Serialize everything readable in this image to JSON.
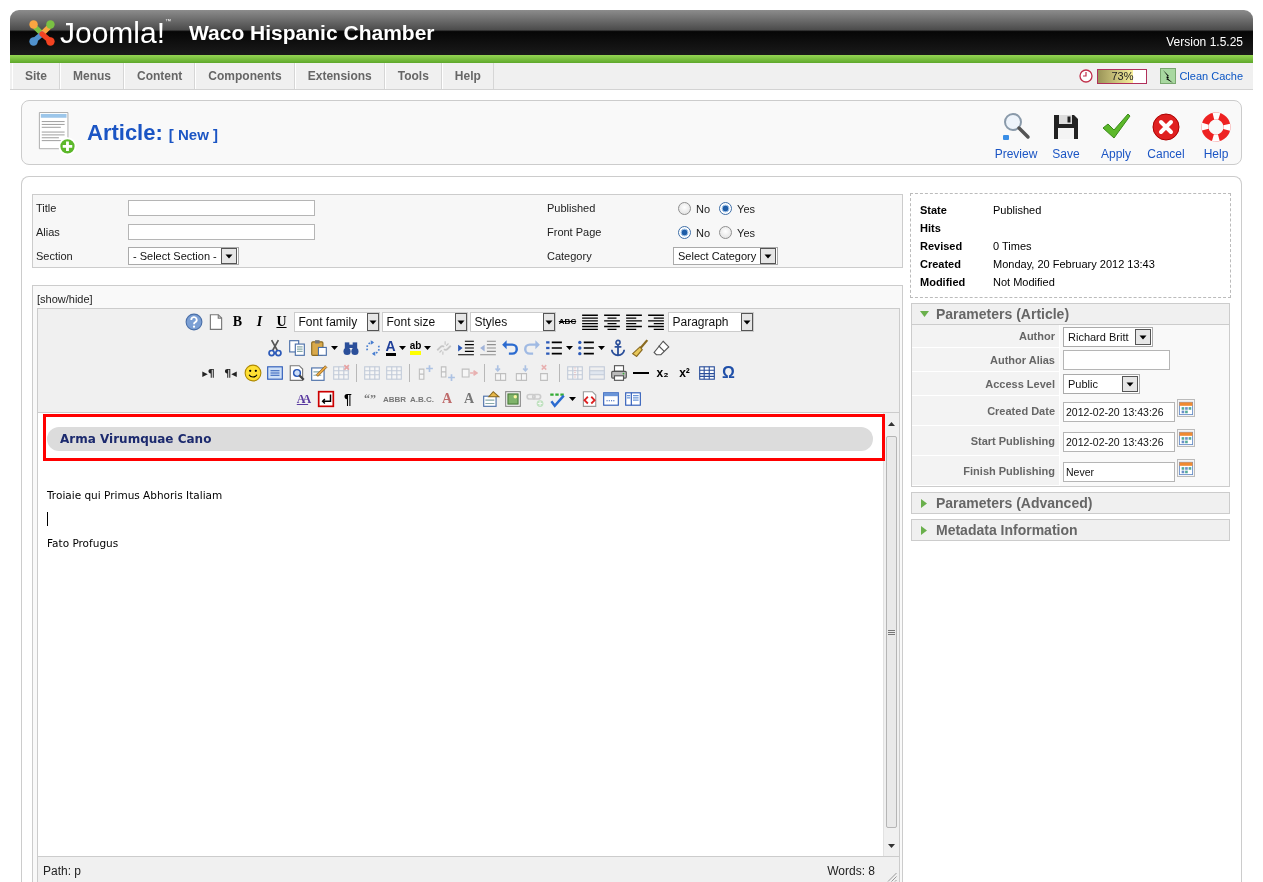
{
  "header": {
    "logo_text": "Joomla!$^{™}$",
    "site_name": "Waco Hispanic Chamber",
    "version": "Version 1.5.25"
  },
  "menu": {
    "items": [
      "Site",
      "Menus",
      "Content",
      "Components",
      "Extensions",
      "Tools",
      "Help"
    ],
    "session": {
      "level": 0.73,
      "reading": "73%"
    },
    "clean_cache": "Clean Cache"
  },
  "page_toolbar": {
    "title": "Article:",
    "subtitle": "[ New ]",
    "buttons": [
      "Preview",
      "Save",
      "Apply",
      "Cancel",
      "Help"
    ]
  },
  "form": {
    "rows": [
      [
        {
          "label": "Title",
          "kind": "text"
        },
        {
          "label": "Published",
          "kind": "radio",
          "options": [
            {
              "label": "No",
              "selected": false
            },
            {
              "label": "Yes",
              "selected": true
            }
          ]
        }
      ],
      [
        {
          "label": "Alias",
          "kind": "text"
        },
        {
          "label": "Front Page",
          "kind": "radio",
          "options": [
            {
              "label": "No",
              "selected": true
            },
            {
              "label": "Yes",
              "selected": false
            }
          ]
        }
      ],
      [
        {
          "label": "Section",
          "kind": "select",
          "value": "- Select Section -"
        },
        {
          "label": "Category",
          "kind": "select",
          "value": "Select Category"
        }
      ]
    ]
  },
  "editor": {
    "toggle": "[show/hide]",
    "toolbar": {
      "rows": [
        {
          "groups": [
            [
              {
                "kind": "icon",
                "disabled": false
              },
              {
                "kind": "icon",
                "disabled": false
              },
              {
                "kind": "glyph",
                "label": "B",
                "disabled": false
              },
              {
                "kind": "glyph",
                "label": "I",
                "disabled": false
              },
              {
                "kind": "glyph",
                "label": "U",
                "disabled": false
              },
              {
                "kind": "select",
                "label": "Font family",
                "disabled": false
              },
              {
                "kind": "select",
                "label": "Font size",
                "disabled": false
              },
              {
                "kind": "select",
                "label": "Styles",
                "disabled": false
              },
              {
                "kind": "glyph",
                "label": "ABC",
                "disabled": false
              },
              {
                "kind": "icon",
                "disabled": false
              },
              {
                "kind": "icon",
                "disabled": false
              },
              {
                "kind": "icon",
                "disabled": false
              },
              {
                "kind": "icon",
                "disabled": false
              },
              {
                "kind": "select",
                "label": "Paragraph",
                "disabled": false
              }
            ]
          ]
        },
        {
          "groups": [
            [
              {
                "kind": "icon",
                "disabled": false
              },
              {
                "kind": "icon",
                "disabled": false
              },
              {
                "kind": "icon",
                "disabled": false
              },
              {
                "kind": "icon",
                "disabled": false
              },
              {
                "kind": "icon",
                "disabled": false
              },
              {
                "kind": "glyph",
                "label": "A",
                "disabled": false
              },
              {
                "kind": "glyph",
                "label": "ab",
                "disabled": false
              },
              {
                "kind": "icon",
                "disabled": true
              },
              {
                "kind": "icon",
                "disabled": false
              },
              {
                "kind": "icon",
                "disabled": true
              },
              {
                "kind": "icon",
                "disabled": false
              },
              {
                "kind": "icon",
                "disabled": true
              },
              {
                "kind": "icon",
                "disabled": false
              },
              {
                "kind": "icon",
                "disabled": false
              },
              {
                "kind": "icon",
                "disabled": false
              },
              {
                "kind": "icon",
                "disabled": false
              },
              {
                "kind": "icon",
                "disabled": false
              }
            ]
          ]
        },
        {
          "groups": [
            [
              {
                "kind": "glyph",
                "label": "▸¶",
                "disabled": false
              },
              {
                "kind": "glyph",
                "label": "¶◂",
                "disabled": false
              },
              {
                "kind": "icon",
                "disabled": false
              },
              {
                "kind": "icon",
                "disabled": false
              },
              {
                "kind": "icon",
                "disabled": false
              },
              {
                "kind": "icon",
                "disabled": false
              },
              {
                "kind": "icon",
                "disabled": true
              }
            ],
            [
              {
                "kind": "icon",
                "disabled": true
              },
              {
                "kind": "icon",
                "disabled": true
              }
            ],
            [
              {
                "kind": "icon",
                "disabled": true
              },
              {
                "kind": "icon",
                "disabled": true
              },
              {
                "kind": "icon",
                "disabled": true
              }
            ],
            [
              {
                "kind": "icon",
                "disabled": true
              },
              {
                "kind": "icon",
                "disabled": true
              },
              {
                "kind": "icon",
                "disabled": true
              }
            ],
            [
              {
                "kind": "icon",
                "disabled": true
              },
              {
                "kind": "icon",
                "disabled": true
              },
              {
                "kind": "icon",
                "disabled": false
              },
              {
                "kind": "icon",
                "disabled": false
              },
              {
                "kind": "glyph",
                "label": "x₂",
                "disabled": false
              },
              {
                "kind": "glyph",
                "label": "x²",
                "disabled": false
              },
              {
                "kind": "icon",
                "disabled": false
              },
              {
                "kind": "glyph",
                "label": "Ω",
                "disabled": false
              }
            ]
          ]
        },
        {
          "groups": [
            [
              {
                "kind": "glyph",
                "label": "AA",
                "disabled": false
              },
              {
                "kind": "icon",
                "disabled": false
              },
              {
                "kind": "glyph",
                "label": "¶",
                "disabled": false
              },
              {
                "kind": "glyph",
                "label": "“”",
                "disabled": true
              },
              {
                "kind": "glyph",
                "label": "ABBR",
                "disabled": true
              },
              {
                "kind": "glyph",
                "label": "A.B.C.",
                "disabled": true
              },
              {
                "kind": "glyph",
                "label": "A",
                "disabled": true
              },
              {
                "kind": "glyph",
                "label": "A",
                "disabled": true
              },
              {
                "kind": "icon",
                "disabled": false
              },
              {
                "kind": "icon",
                "disabled": false
              },
              {
                "kind": "icon",
                "disabled": true
              },
              {
                "kind": "icon",
                "disabled": false
              },
              {
                "kind": "icon",
                "disabled": false
              },
              {
                "kind": "icon",
                "disabled": false
              },
              {
                "kind": "icon",
                "disabled": false
              }
            ]
          ]
        }
      ]
    },
    "content": [
      {
        "kind": "heading",
        "text": "Arma Virumquae Cano"
      },
      {
        "kind": "paragraph",
        "text": "Troiaie qui Primus Abhoris Italiam"
      },
      {
        "kind": "cursor"
      },
      {
        "kind": "paragraph",
        "text": "Fato Profugus"
      }
    ],
    "path": "Path: p",
    "word_count": "Words: 8"
  },
  "details": {
    "rows": [
      {
        "label": "State",
        "value": "Published"
      },
      {
        "label": "Hits"
      },
      {
        "label": "Revised",
        "value": "0 Times"
      },
      {
        "label": "Created",
        "value": "Monday, 20 February 2012 13:43"
      },
      {
        "label": "Modified",
        "value": "Not Modified"
      }
    ]
  },
  "panels": [
    {
      "title": "Parameters (Article)",
      "expanded": true,
      "rows": [
        {
          "label": "Author",
          "kind": "select",
          "value": "Richard Britt"
        },
        {
          "label": "Author Alias",
          "kind": "text"
        },
        {
          "label": "Access Level",
          "kind": "select",
          "value": "Public"
        },
        {
          "label": "Created Date",
          "kind": "date",
          "value": "2012-02-20 13:43:26"
        },
        {
          "label": "Start Publishing",
          "kind": "date",
          "value": "2012-02-20 13:43:26"
        },
        {
          "label": "Finish Publishing",
          "kind": "date",
          "value": "Never"
        }
      ]
    },
    {
      "title": "Parameters (Advanced)",
      "expanded": false
    },
    {
      "title": "Metadata Information",
      "expanded": false
    }
  ]
}
